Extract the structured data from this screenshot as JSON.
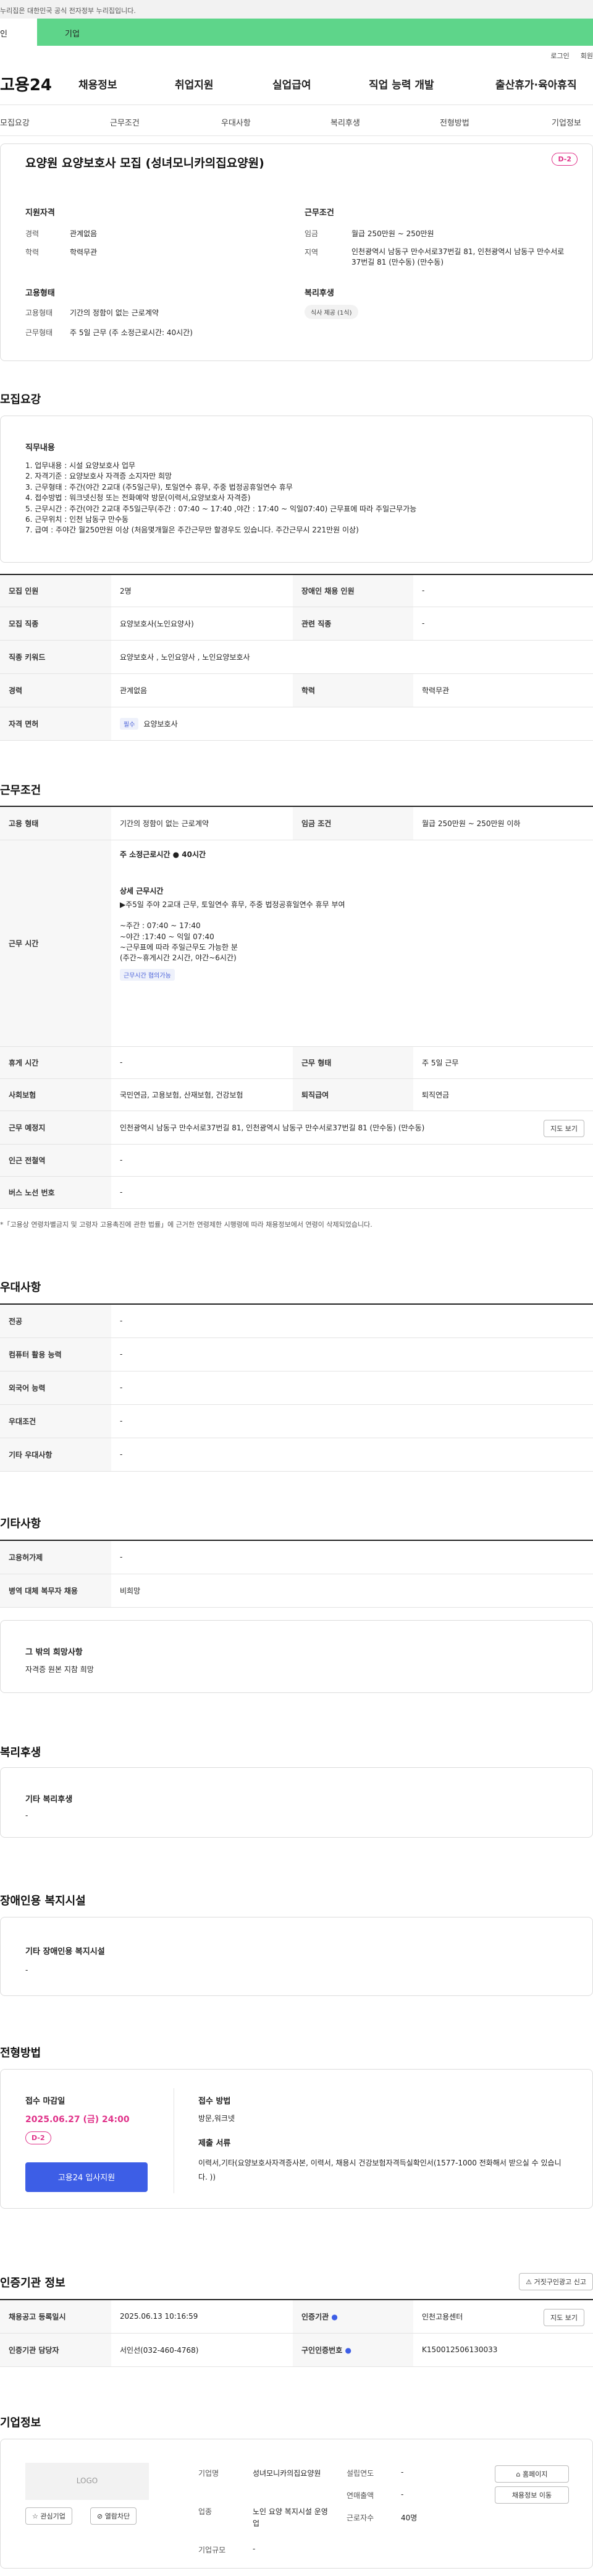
{
  "gov_notice": "누리집은 대한민국 공식 전자정부 누리집입니다.",
  "tabs": {
    "personal": "인",
    "corporate": "기업"
  },
  "util": {
    "login": "로그인",
    "join": "회원"
  },
  "gnb": {
    "logo": "고용24",
    "items": [
      "채용정보",
      "취업지원",
      "실업급여",
      "직업 능력 개발",
      "출산휴가·육아휴직"
    ]
  },
  "subnav": [
    "모집요강",
    "근무조건",
    "우대사항",
    "복리후생",
    "전형방법",
    "기업정보"
  ],
  "summary": {
    "title": "요양원 요양보호사 모집 (성녀모니카의집요양원)",
    "dday": "D-2",
    "qualification_title": "지원자격",
    "career_label": "경력",
    "career_value": "관계없음",
    "edu_label": "학력",
    "edu_value": "학력무관",
    "employment_title": "고용형태",
    "emptype_label": "고용형태",
    "emptype_value": "기간의 정함이 없는 근로계약",
    "worktype_label": "근무형태",
    "worktype_value": "주 5일 근무 (주 소정근로시간: 40시간)",
    "condition_title": "근무조건",
    "wage_label": "임금",
    "wage_value": "월급 250만원 ~ 250만원",
    "region_label": "지역",
    "region_value": "인천광역시 남동구 만수서로37번길 81, 인천광역시 남동구 만수서로37번길 81 (만수동) (만수동)",
    "welfare_title": "복리후생",
    "welfare_chip": "식사 제공 (1식)"
  },
  "recruit": {
    "section_title": "모집요강",
    "duty_title": "직무내용",
    "duty_text": "1. 업무내용 : 시설 요양보호사 업무\n2. 자격기준 : 요양보호사 자격증 소지자만 희망\n3. 근무형태 : 주간(야간 2교대 (주5일근무), 토일연수 휴무, 주중 법정공휴일연수 휴무\n4. 접수방법 : 워크넷신청 또는 전화예약 방문(이력서,요양보호사 자격증)\n5. 근무시간 : 주간(야간 2교대 주5일근무(주간 : 07:40 ~ 17:40 ,야간 : 17:40 ~ 익일07:40) 근무표에 따라 주일근무가능\n6. 근무위치 : 인천 남동구 만수동\n7. 급여 : 주야간 월250만원 이상 (처음몇개월은 주간근무만 할경우도 있습니다. 주간근무시 221만원 이상)",
    "rows": [
      {
        "k1": "모집 인원",
        "v1": "2명",
        "k2": "장애인 채용 인원",
        "v2": "-"
      },
      {
        "k1": "모집 직종",
        "v1": "요양보호사(노인요양사)",
        "k2": "관련 직종",
        "v2": "-"
      },
      {
        "k1": "직종 키워드",
        "v1": "요양보호사 , 노인요양사 , 노인요양보호사"
      },
      {
        "k1": "경력",
        "v1": "관계없음",
        "k2": "학력",
        "v2": "학력무관"
      },
      {
        "k1": "자격 면허",
        "chip": "필수",
        "v1": "요양보호사"
      }
    ]
  },
  "workcond": {
    "section_title": "근무조건",
    "emptype_label": "고용 형태",
    "emptype_value": "기간의 정함이 없는 근로계약",
    "wage_label": "임금 조건",
    "wage_value": "월급 250만원 ~ 250만원 이하",
    "worktime_label": "근무 시간",
    "weekly_hours": "주 소정근로시간 ● 40시간",
    "detail_title": "상세 근무시간",
    "detail_text": "▶주5일 주야 2교대 근무, 토일연수 휴무, 주중 법정공휴일연수 휴무 부여\n\n~주간 : 07:40 ~ 17:40\n~야간 :17:40 ~ 익일 07:40\n~근무표에 따라 주일근무도 가능한 분\n(주간~휴게시간 2시간, 야간~6시간)",
    "detail_chip": "근무시간 협의가능",
    "rest_label": "휴게 시간",
    "rest_value": "-",
    "form_label": "근무 형태",
    "form_value": "주 5일 근무",
    "insurance_label": "사회보험",
    "insurance_value": "국민연금, 고용보험, 산재보험, 건강보험",
    "severance_label": "퇴직급여",
    "severance_value": "퇴직연금",
    "place_label": "근무 예정지",
    "place_value": "인천광역시 남동구 만수서로37번길 81, 인천광역시 남동구 만수서로37번길 81 (만수동) (만수동)",
    "map_button": "지도 보기",
    "station_label": "인근 전철역",
    "station_value": "-",
    "bus_label": "버스 노선 번호",
    "bus_value": "-",
    "footnote": "*「고용상 연령차별금지 및 고령자 고용촉진에 관한 법률」에 근거한 연령제한 시행령에 따라 채용정보에서 연령이 삭제되었습니다."
  },
  "preference": {
    "section_title": "우대사항",
    "rows": [
      {
        "k": "전공",
        "v": "-"
      },
      {
        "k": "컴퓨터 활용 능력",
        "v": "-"
      },
      {
        "k": "외국어 능력",
        "v": "-"
      },
      {
        "k": "우대조건",
        "v": "-"
      },
      {
        "k": "기타 우대사항",
        "v": "-"
      }
    ]
  },
  "other": {
    "section_title": "기타사항",
    "rows": [
      {
        "k": "고용허가제",
        "v": "-"
      },
      {
        "k": "병역 대체 복무자 채용",
        "v": "비희망"
      }
    ],
    "box_title": "그 밖의 희망사항",
    "box_text": "자격증 원본 지참 희망"
  },
  "welfare": {
    "section_title": "복리후생",
    "box_title": "기타 복리후생",
    "box_text": "-"
  },
  "disability": {
    "section_title": "장애인용 복지시설",
    "box_title": "기타 장애인용 복지시설",
    "box_text": "-"
  },
  "selection": {
    "section_title": "전형방법",
    "deadline_label": "접수 마감일",
    "deadline_value": "2025.06.27 (금) 24:00",
    "dday": "D-2",
    "apply_button": "고용24 입사지원",
    "method_label": "접수 방법",
    "method_value": "방문,워크넷",
    "docs_label": "제출 서류",
    "docs_value": "이력서,기타(요양보호사자격증사본, 이력서,  채용시 건강보험자격득실확인서(1577-1000 전화해서 받으실 수 있습니다. ))"
  },
  "cert": {
    "section_title": "인증기관 정보",
    "report_button": "거짓구인광고 신고",
    "rows": [
      {
        "k1": "채용공고 등록일시",
        "v1": "2025.06.13 10:16:59",
        "k2": "인증기관",
        "v2": "인천고용센터",
        "btn": "지도 보기"
      },
      {
        "k1": "인증기관 담당자",
        "v1": "서인선(032-460-4768)",
        "k2": "구인인증번호",
        "v2": "K150012506130033"
      }
    ]
  },
  "company": {
    "section_title": "기업정보",
    "logo_text": "LOGO",
    "fav_button": "관심기업",
    "block_button": "열람차단",
    "name_label": "기업명",
    "name_value": "성녀모니카의집요양원",
    "industry_label": "업종",
    "industry_value": "노인 요양 복지시설 운영업",
    "size_label": "기업규모",
    "size_value": "-",
    "founded_label": "설립연도",
    "founded_value": "-",
    "sales_label": "연매출액",
    "sales_value": "-",
    "employees_label": "근로자수",
    "employees_value": "40명",
    "homepage_button": "홈페이지",
    "jobs_button": "채용정보 이동"
  }
}
